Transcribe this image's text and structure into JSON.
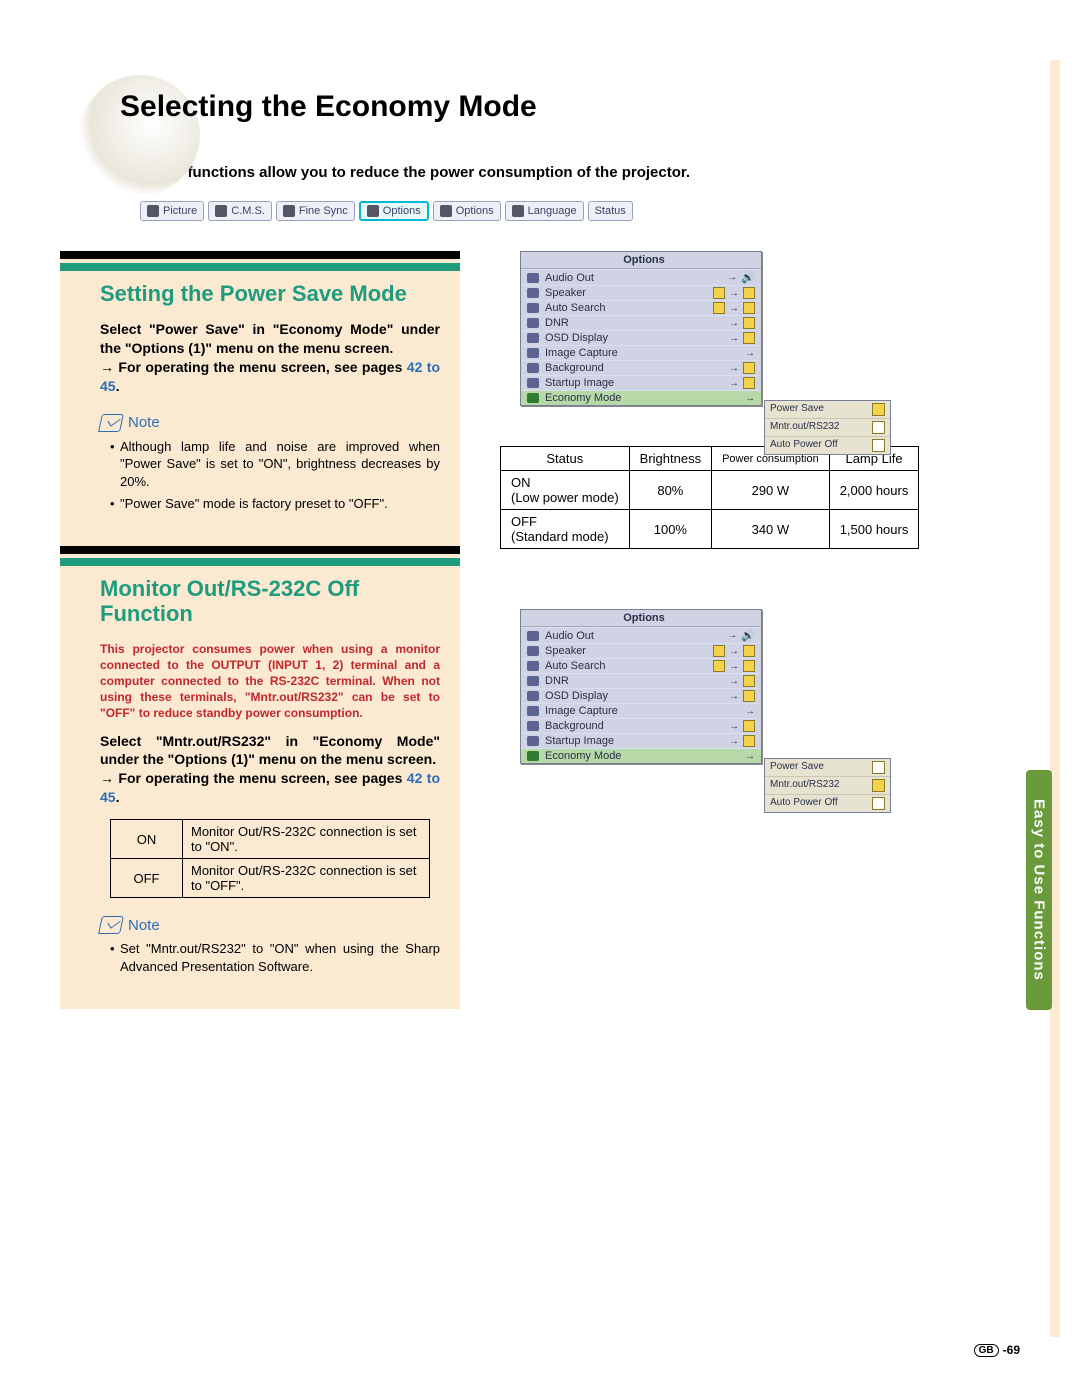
{
  "page_title": "Selecting the Economy Mode",
  "intro": "These functions allow you to reduce the power consumption of the projector.",
  "tabs": [
    "Picture",
    "C.M.S.",
    "Fine Sync",
    "Options",
    "Options",
    "Language",
    "Status"
  ],
  "section1": {
    "title": "Setting the Power Save Mode",
    "instr1": "Select \"Power Save\" in \"Economy Mode\" under the \"Options (1)\" menu on the menu screen.",
    "instr2a": "→ For operating the menu screen, see pages ",
    "instr2b": "42 to 45",
    "instr2c": ".",
    "note_label": "Note",
    "note1": "Although lamp life and noise are improved when \"Power Save\" is set to \"ON\", brightness decreases by 20%.",
    "note2": "\"Power Save\" mode is factory preset to \"OFF\"."
  },
  "power_table": {
    "headers": [
      "Status",
      "Brightness",
      "Power consumption",
      "Lamp Life"
    ],
    "rows": [
      {
        "status": "ON\n(Low power mode)",
        "brightness": "80%",
        "power": "290 W",
        "lamp": "2,000 hours"
      },
      {
        "status": "OFF\n(Standard mode)",
        "brightness": "100%",
        "power": "340 W",
        "lamp": "1,500 hours"
      }
    ]
  },
  "section2": {
    "title": "Monitor Out/RS-232C Off Function",
    "red": "This projector consumes power when using a monitor connected to the OUTPUT (INPUT 1, 2) terminal and a computer connected to the RS-232C terminal. When not using these terminals, \"Mntr.out/RS232\" can be set to \"OFF\" to reduce standby power consumption.",
    "instr1": "Select \"Mntr.out/RS232\" in \"Economy Mode\" under the \"Options (1)\" menu on the menu screen.",
    "instr2a": "→ For operating the menu screen, see pages ",
    "instr2b": "42 to 45",
    "instr2c": ".",
    "onoff": {
      "on_label": "ON",
      "on_text": "Monitor Out/RS-232C connection is set to \"ON\".",
      "off_label": "OFF",
      "off_text": "Monitor Out/RS-232C connection is set to \"OFF\"."
    },
    "note_label": "Note",
    "note1": "Set \"Mntr.out/RS232\" to \"ON\" when using the Sharp Advanced Presentation Software."
  },
  "osd": {
    "title": "Options",
    "rows": [
      "Audio Out",
      "Speaker",
      "Auto Search",
      "DNR",
      "OSD Display",
      "Image Capture",
      "Background",
      "Startup Image",
      "Economy Mode"
    ],
    "submenu": {
      "power_save": "Power Save",
      "mntr": "Mntr.out/RS232",
      "auto": "Auto Power Off"
    }
  },
  "side_tab": "Easy to Use Functions",
  "page_number_region": "GB",
  "page_number": "-69"
}
